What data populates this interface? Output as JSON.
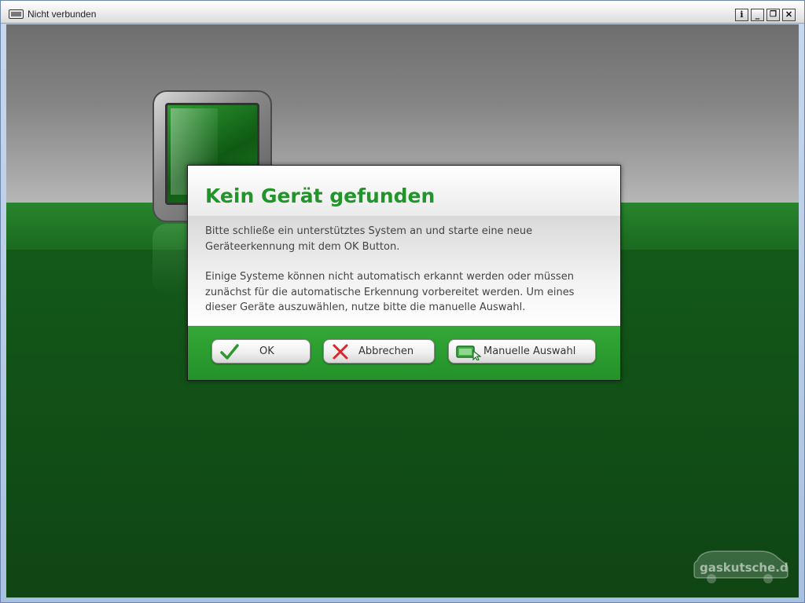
{
  "window": {
    "title": "Nicht verbunden",
    "controls": {
      "info": "i",
      "minimize": "_",
      "restore": "❐",
      "close": "✕"
    }
  },
  "dialog": {
    "title": "Kein Gerät gefunden",
    "paragraph1": "Bitte schließe ein unterstütztes System an und starte eine neue Geräteerkennung mit dem OK Button.",
    "paragraph2": "Einige Systeme können nicht automatisch erkannt werden oder müssen zunächst für die automatische Erkennung vorbereitet werden. Um eines dieser Geräte auszuwählen, nutze bitte die manuelle Auswahl.",
    "buttons": {
      "ok": "OK",
      "cancel": "Abbrechen",
      "manual": "Manuelle Auswahl"
    }
  },
  "logo": {
    "text": "gaskutsche.de"
  },
  "colors": {
    "accent_green": "#22952a",
    "footer_green": "#2a9e2e",
    "floor_green": "#145a1a"
  },
  "icons": {
    "window_icon": "monitor-icon",
    "ok_icon": "check-icon",
    "cancel_icon": "x-icon",
    "manual_icon": "device-pointer-icon"
  }
}
